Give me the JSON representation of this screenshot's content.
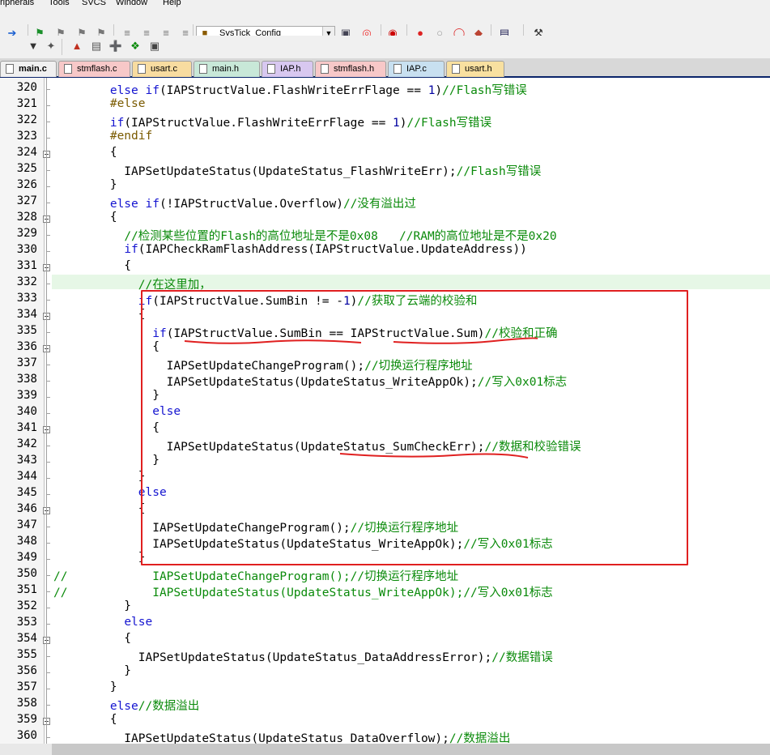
{
  "menu": [
    "ripherals",
    "Tools",
    "SVCS",
    "Window",
    "Help"
  ],
  "toolbar": {
    "target_select": "SysTick_Config",
    "icons1": [
      "navigate-forward-icon",
      "bookmark-toggle-icon",
      "bookmark-prev-icon",
      "bookmark-next-icon",
      "bookmark-clear-icon",
      "indent-icon",
      "unindent-icon",
      "comment-icon",
      "uncomment-icon",
      "find-in-files-icon",
      "browse-icon",
      "debug-start-icon",
      "breakpoint-insert-icon",
      "breakpoint-enable-icon",
      "breakpoint-disable-icon",
      "breakpoint-kill-icon",
      "window-layout-icon",
      "configure-icon"
    ],
    "icons2": [
      "dropdown-icon",
      "magic-wand-icon",
      "build-target-icon",
      "rebuild-icon",
      "download-icon",
      "load-icon",
      "options-icon"
    ]
  },
  "tabs": [
    {
      "label": "main.c",
      "active": true,
      "color": "#f0f0f0"
    },
    {
      "label": "stmflash.c",
      "active": false,
      "color": "#f7c8c8"
    },
    {
      "label": "usart.c",
      "active": false,
      "color": "#f8dca0"
    },
    {
      "label": "main.h",
      "active": false,
      "color": "#c8e8d8"
    },
    {
      "label": "IAP.h",
      "active": false,
      "color": "#d8c8f0"
    },
    {
      "label": "stmflash.h",
      "active": false,
      "color": "#f7c8c8"
    },
    {
      "label": "IAP.c",
      "active": false,
      "color": "#c8e0f0"
    },
    {
      "label": "usart.h",
      "active": false,
      "color": "#f8e0a0"
    }
  ],
  "code": [
    {
      "n": "320",
      "t": [
        [
          "        ",
          ""
        ],
        [
          "else if",
          "kw"
        ],
        [
          "(IAPStructValue.FlashWriteErrFlage == ",
          ""
        ],
        [
          "1",
          "num"
        ],
        [
          ")",
          ""
        ],
        [
          "//Flash写错误",
          "cm"
        ]
      ]
    },
    {
      "n": "321",
      "t": [
        [
          "        ",
          ""
        ],
        [
          "#else",
          "pp"
        ]
      ]
    },
    {
      "n": "322",
      "t": [
        [
          "        ",
          ""
        ],
        [
          "if",
          "kw"
        ],
        [
          "(IAPStructValue.FlashWriteErrFlage == ",
          ""
        ],
        [
          "1",
          "num"
        ],
        [
          ")",
          ""
        ],
        [
          "//Flash写错误",
          "cm"
        ]
      ]
    },
    {
      "n": "323",
      "t": [
        [
          "        ",
          ""
        ],
        [
          "#endif",
          "pp"
        ]
      ]
    },
    {
      "n": "324",
      "t": [
        [
          "        {",
          ""
        ]
      ]
    },
    {
      "n": "325",
      "t": [
        [
          "          IAPSetUpdateStatus(UpdateStatus_FlashWriteErr);",
          ""
        ],
        [
          "//Flash写错误",
          "cm"
        ]
      ]
    },
    {
      "n": "326",
      "t": [
        [
          "        }",
          ""
        ]
      ]
    },
    {
      "n": "327",
      "t": [
        [
          "        ",
          ""
        ],
        [
          "else if",
          "kw"
        ],
        [
          "(!IAPStructValue.Overflow)",
          ""
        ],
        [
          "//没有溢出过",
          "cm"
        ]
      ]
    },
    {
      "n": "328",
      "t": [
        [
          "        {",
          ""
        ]
      ]
    },
    {
      "n": "329",
      "t": [
        [
          "          ",
          ""
        ],
        [
          "//检测某些位置的Flash的高位地址是不是0x08   //RAM的高位地址是不是0x20",
          "cm"
        ]
      ]
    },
    {
      "n": "330",
      "t": [
        [
          "          ",
          ""
        ],
        [
          "if",
          "kw"
        ],
        [
          "(IAPCheckRamFlashAddress(IAPStructValue.UpdateAddress))",
          ""
        ]
      ]
    },
    {
      "n": "331",
      "t": [
        [
          "          {",
          ""
        ]
      ]
    },
    {
      "n": "332",
      "t": [
        [
          "            ",
          ""
        ],
        [
          "//在这里加，",
          "cm"
        ]
      ]
    },
    {
      "n": "333",
      "t": [
        [
          "            ",
          ""
        ],
        [
          "if",
          "kw"
        ],
        [
          "(IAPStructValue.SumBin != -",
          ""
        ],
        [
          "1",
          "num"
        ],
        [
          ")",
          ""
        ],
        [
          "//获取了云端的校验和",
          "cm"
        ]
      ]
    },
    {
      "n": "334",
      "t": [
        [
          "            {",
          ""
        ]
      ]
    },
    {
      "n": "335",
      "t": [
        [
          "              ",
          ""
        ],
        [
          "if",
          "kw"
        ],
        [
          "(IAPStructValue.SumBin == IAPStructValue.Sum)",
          ""
        ],
        [
          "//校验和正确",
          "cm"
        ]
      ]
    },
    {
      "n": "336",
      "t": [
        [
          "              {",
          ""
        ]
      ]
    },
    {
      "n": "337",
      "t": [
        [
          "                IAPSetUpdateChangeProgram();",
          ""
        ],
        [
          "//切换运行程序地址",
          "cm"
        ]
      ]
    },
    {
      "n": "338",
      "t": [
        [
          "                IAPSetUpdateStatus(UpdateStatus_WriteAppOk);",
          ""
        ],
        [
          "//写入0x01标志",
          "cm"
        ]
      ]
    },
    {
      "n": "339",
      "t": [
        [
          "              }",
          ""
        ]
      ]
    },
    {
      "n": "340",
      "t": [
        [
          "              ",
          ""
        ],
        [
          "else",
          "kw"
        ]
      ]
    },
    {
      "n": "341",
      "t": [
        [
          "              {",
          ""
        ]
      ]
    },
    {
      "n": "342",
      "t": [
        [
          "                IAPSetUpdateStatus(UpdateStatus_SumCheckErr);",
          ""
        ],
        [
          "//数据和校验错误",
          "cm"
        ]
      ]
    },
    {
      "n": "343",
      "t": [
        [
          "              }",
          ""
        ]
      ]
    },
    {
      "n": "344",
      "t": [
        [
          "            }",
          ""
        ]
      ]
    },
    {
      "n": "345",
      "t": [
        [
          "            ",
          ""
        ],
        [
          "else",
          "kw"
        ]
      ]
    },
    {
      "n": "346",
      "t": [
        [
          "            {",
          ""
        ]
      ]
    },
    {
      "n": "347",
      "t": [
        [
          "              IAPSetUpdateChangeProgram();",
          ""
        ],
        [
          "//切换运行程序地址",
          "cm"
        ]
      ]
    },
    {
      "n": "348",
      "t": [
        [
          "              IAPSetUpdateStatus(UpdateStatus_WriteAppOk);",
          ""
        ],
        [
          "//写入0x01标志",
          "cm"
        ]
      ]
    },
    {
      "n": "349",
      "t": [
        [
          "            }",
          ""
        ]
      ]
    },
    {
      "n": "350",
      "t": [
        [
          "//            IAPSetUpdateChangeProgram();//切换运行程序地址",
          "cm"
        ]
      ]
    },
    {
      "n": "351",
      "t": [
        [
          "//            IAPSetUpdateStatus(UpdateStatus_WriteAppOk);//写入0x01标志",
          "cm"
        ]
      ]
    },
    {
      "n": "352",
      "t": [
        [
          "          }",
          ""
        ]
      ]
    },
    {
      "n": "353",
      "t": [
        [
          "          ",
          ""
        ],
        [
          "else",
          "kw"
        ]
      ]
    },
    {
      "n": "354",
      "t": [
        [
          "          {",
          ""
        ]
      ]
    },
    {
      "n": "355",
      "t": [
        [
          "            IAPSetUpdateStatus(UpdateStatus_DataAddressError);",
          ""
        ],
        [
          "//数据错误",
          "cm"
        ]
      ]
    },
    {
      "n": "356",
      "t": [
        [
          "          }",
          ""
        ]
      ]
    },
    {
      "n": "357",
      "t": [
        [
          "        }",
          ""
        ]
      ]
    },
    {
      "n": "358",
      "t": [
        [
          "        ",
          ""
        ],
        [
          "else",
          "kw"
        ],
        [
          "//数据溢出",
          "cm"
        ]
      ]
    },
    {
      "n": "359",
      "t": [
        [
          "        {",
          ""
        ]
      ]
    },
    {
      "n": "360",
      "t": [
        [
          "          IAPSetUpdateStatus(UpdateStatus_DataOverflow);",
          ""
        ],
        [
          "//数据溢出",
          "cm"
        ]
      ]
    }
  ],
  "folds": [
    "324",
    "328",
    "331",
    "334",
    "336",
    "341",
    "346",
    "354",
    "359"
  ]
}
